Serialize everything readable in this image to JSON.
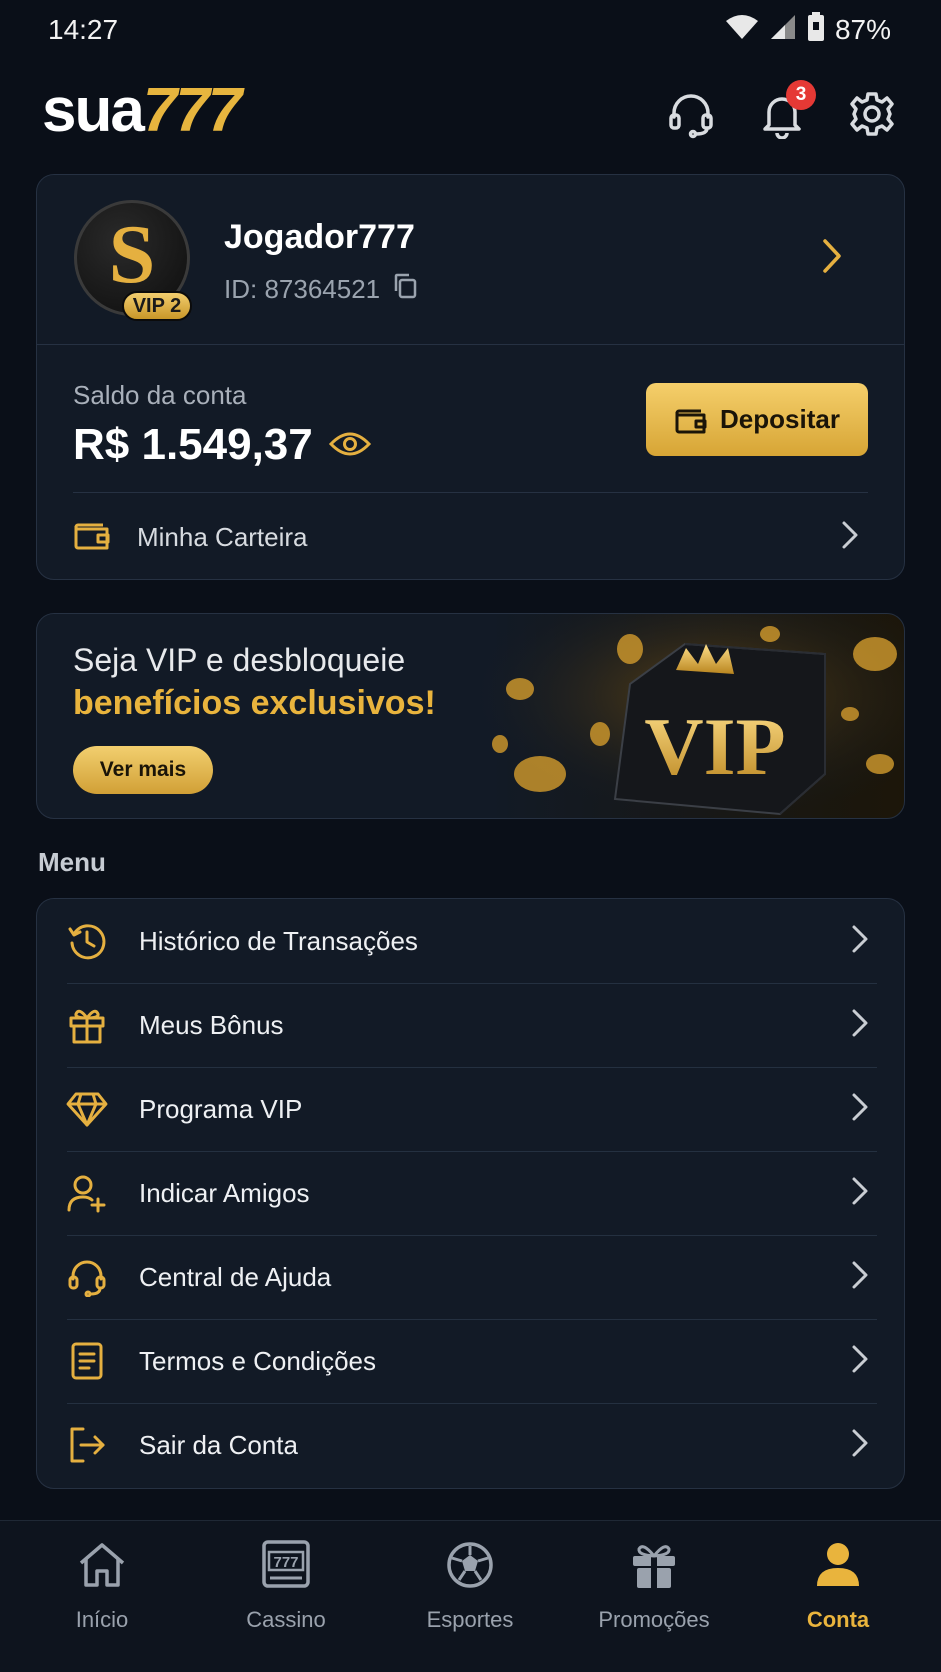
{
  "status_bar": {
    "time": "14:27",
    "battery": "87%"
  },
  "header": {
    "logo_white": "sua",
    "logo_gold": "777",
    "notification_count": "3",
    "icons": [
      "headset-icon",
      "bell-icon",
      "gear-icon"
    ]
  },
  "profile": {
    "avatar_letter": "S",
    "vip_level": "VIP 2",
    "username": "Jogador777",
    "id_text": "ID: 87364521"
  },
  "balance": {
    "label": "Saldo da conta",
    "value": "R$ 1.549,37",
    "deposit_label": "Depositar",
    "wallet_label": "Minha Carteira"
  },
  "vip_banner": {
    "line1": "Seja VIP e desbloqueie",
    "line2": "benefícios exclusivos!",
    "button_label": "Ver mais",
    "art_text": "VIP"
  },
  "menu": {
    "title": "Menu",
    "items": [
      {
        "label": "Histórico de Transações",
        "icon": "history-icon"
      },
      {
        "label": "Meus Bônus",
        "icon": "gift-icon"
      },
      {
        "label": "Programa VIP",
        "icon": "diamond-icon"
      },
      {
        "label": "Indicar Amigos",
        "icon": "add-user-icon"
      },
      {
        "label": "Central de Ajuda",
        "icon": "headset-icon"
      },
      {
        "label": "Termos e Condições",
        "icon": "document-icon"
      },
      {
        "label": "Sair da Conta",
        "icon": "logout-icon"
      }
    ]
  },
  "bottom_nav": {
    "items": [
      {
        "label": "Início",
        "icon": "home-icon"
      },
      {
        "label": "Cassino",
        "icon": "slot-machine-icon",
        "icon_text": "777"
      },
      {
        "label": "Esportes",
        "icon": "soccer-ball-icon"
      },
      {
        "label": "Promoções",
        "icon": "gift-icon"
      },
      {
        "label": "Conta",
        "icon": "user-icon",
        "active": true
      }
    ]
  },
  "colors": {
    "background": "#0a0f18",
    "card": "#121a26",
    "accent_gold": "#e9b43d",
    "badge_red": "#e53935"
  }
}
